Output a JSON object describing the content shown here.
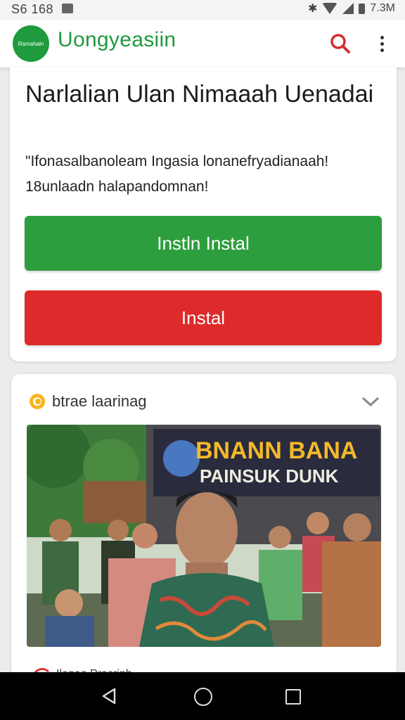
{
  "status_bar": {
    "time": "S6 168",
    "right_text": "7.3M",
    "icons": [
      "image-icon",
      "bluetooth-icon",
      "wifi-icon",
      "signal-icon",
      "battery-icon"
    ]
  },
  "app_bar": {
    "title": "Uongyeasiin",
    "logo_text": "Ramahaln",
    "brand_color": "#1e9a3f"
  },
  "install_card": {
    "title": "Narlalian Ulan Nimaaah Uenadai",
    "description": "\"Ifonasalbanoleam Ingasia lonanefryadianaah! 18unlaadn halapandomnan!",
    "primary_button": "Instln Instal",
    "secondary_button": "Instal",
    "primary_color": "#2d9e3d",
    "secondary_color": "#de2a2a"
  },
  "news_card": {
    "section_label": "btrae laarinag",
    "banner_line1": "BNANN BANA",
    "banner_line2": "PAINSUK DUNK",
    "next_item_label": "Ilanaa Prasrinh"
  }
}
